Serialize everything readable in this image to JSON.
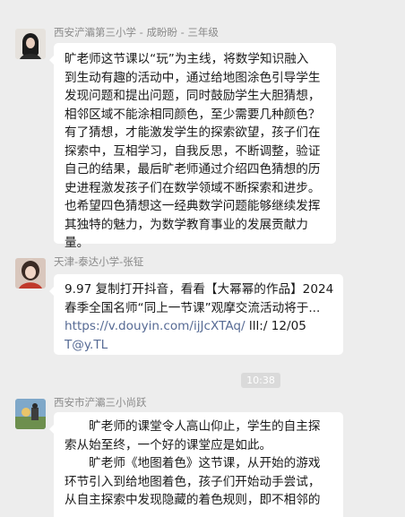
{
  "messages": [
    {
      "sender": "西安浐灞第三小学 - 成盼盼 - 三年级",
      "avatar_icon": "user-avatar-dark-hair",
      "lines": [
        "旷老师这节课以“玩”为主线，将数学知识融入",
        "到生动有趣的活动中，通过给地图涂色引导学生",
        "发现问题和提出问题，同时鼓励学生大胆猜想，",
        "相邻区域不能涂相同颜色，至少需要几种颜色？",
        "有了猜想，才能激发学生的探索欲望，孩子们在",
        "探索中，互相学习，自我反思，不断调整，验证",
        "自己的结果，最后旷老师通过介绍四色猜想的历",
        "史进程激发孩子们在数学领域不断探索和进步。",
        "也希望四色猜想这一经典数学问题能够继续发挥",
        "其独特的魅力，为数学教育事业的发展贡献力",
        "量。"
      ]
    },
    {
      "sender": "天津-泰达小学-张钲",
      "avatar_icon": "user-avatar-portrait",
      "lines": [
        "9.97 复制打开抖音，看看【大幂幂的作品】2024",
        "春季全国名师“同上一节课”观摩交流活动将于..."
      ],
      "link_url": "https://v.douyin.com/ijJcXTAq/",
      "link_suffix": " lll:/ 12/05",
      "link_tail": "T@y.TL"
    },
    {
      "time": "10:38"
    },
    {
      "sender": "西安市浐灞三小尚跃",
      "avatar_icon": "user-avatar-outdoor-scene",
      "lines": [
        "　　旷老师的课堂令人高山仰止，学生的自主探",
        "索从始至终，一个好的课堂应是如此。",
        "　　旷老师《地图着色》这节课，从开始的游戏",
        "环节引入到给地图着色，孩子们开始动手尝试，",
        "从自主探索中发现隐藏的着色规则，即不相邻的"
      ]
    }
  ],
  "colors": {
    "background": "#ededed",
    "bubble": "#ffffff",
    "link": "#576b95",
    "sender_text": "#8a8a8a",
    "time_pill": "#dadada"
  }
}
